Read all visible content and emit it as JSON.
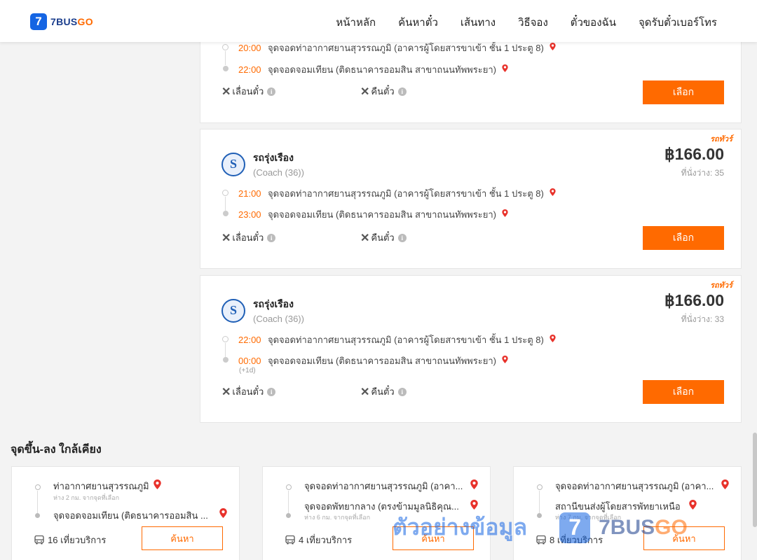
{
  "header": {
    "logo_number": "7",
    "logo_text_main": "7BUS",
    "logo_text_go": "GO",
    "nav": [
      "หน้าหลัก",
      "ค้นหาตั๋ว",
      "เส้นทาง",
      "วิธีจอง",
      "ตั๋วของฉัน",
      "จุดรับตั๋วเบอร์โทร"
    ]
  },
  "trips": [
    {
      "depart_time": "20:00",
      "depart_name": "จุดจอดท่าอากาศยานสุวรรณภูมิ (อาคารผู้โดยสารขาเข้า ชั้น 1 ประตู 8)",
      "arrive_time": "22:00",
      "arrive_name": "จุดจอดจอมเทียน (ติดธนาคารออมสิน สาขาถนนทัพพระยา)",
      "reschedule": "เลื่อนตั๋ว",
      "refund": "คืนตั๋ว",
      "select": "เลือก"
    },
    {
      "badge": "รถทัวร์",
      "operator": "รถรุ่งเรือง",
      "coach": "(Coach (36))",
      "price": "฿166.00",
      "seats": "ที่นั่งว่าง: 35",
      "depart_time": "21:00",
      "depart_name": "จุดจอดท่าอากาศยานสุวรรณภูมิ (อาคารผู้โดยสารขาเข้า ชั้น 1 ประตู 8)",
      "arrive_time": "23:00",
      "arrive_name": "จุดจอดจอมเทียน (ติดธนาคารออมสิน สาขาถนนทัพพระยา)",
      "reschedule": "เลื่อนตั๋ว",
      "refund": "คืนตั๋ว",
      "select": "เลือก"
    },
    {
      "badge": "รถทัวร์",
      "operator": "รถรุ่งเรือง",
      "coach": "(Coach (36))",
      "price": "฿166.00",
      "seats": "ที่นั่งว่าง: 33",
      "depart_time": "22:00",
      "depart_name": "จุดจอดท่าอากาศยานสุวรรณภูมิ (อาคารผู้โดยสารขาเข้า ชั้น 1 ประตู 8)",
      "arrive_time": "00:00",
      "arrive_next_day": "(+1d)",
      "arrive_name": "จุดจอดจอมเทียน (ติดธนาคารออมสิน สาขาถนนทัพพระยา)",
      "reschedule": "เลื่อนตั๋ว",
      "refund": "คืนตั๋ว",
      "select": "เลือก"
    }
  ],
  "nearby": {
    "title": "จุดขึ้น-ลง ใกล้เคียง",
    "cards": [
      {
        "from": "ท่าอากาศยานสุวรรณภูมิ",
        "from_sub": "ห่าง 2 กม. จากจุดที่เลือก",
        "to": "จุดจอดจอมเทียน (ติดธนาคารออมสิน ...",
        "to_sub": "",
        "trips": "16 เที่ยวบริการ",
        "search": "ค้นหา"
      },
      {
        "from": "จุดจอดท่าอากาศยานสุวรรณภูมิ (อาคา...",
        "from_sub": "",
        "to": "จุดจอดพัทยากลาง (ตรงข้ามมูลนิธิคุณ...",
        "to_sub": "ห่าง 6 กม. จากจุดที่เลือก",
        "trips": "4 เที่ยวบริการ",
        "search": "ค้นหา"
      },
      {
        "from": "จุดจอดท่าอากาศยานสุวรรณภูมิ (อาคา...",
        "from_sub": "",
        "to": "สถานีขนส่งผู้โดยสารพัทยาเหนือ",
        "to_sub": "ห่าง 7 กม. จากจุดที่เลือก",
        "trips": "8 เที่ยวบริการ",
        "search": "ค้นหา"
      }
    ]
  },
  "watermark": {
    "text": "ตัวอย่างข้อมูล",
    "badge": "7",
    "brand_main": "7BUS",
    "brand_go": "GO"
  },
  "colors": {
    "accent": "#ff6a00",
    "brand_blue": "#1565e3",
    "pin_red": "#e8322b"
  }
}
